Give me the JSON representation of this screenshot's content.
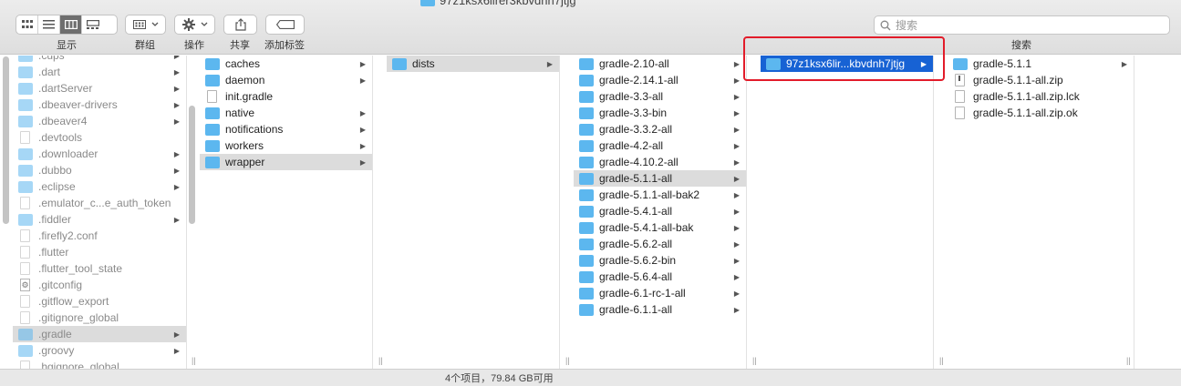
{
  "window": {
    "title": "97z1ksx6lirer3kbvdnh7jtjg"
  },
  "toolbar": {
    "view_label": "显示",
    "group_label": "群组",
    "action_label": "操作",
    "share_label": "共享",
    "tag_label": "添加标签",
    "search_label": "搜索",
    "search_placeholder": "搜索"
  },
  "columns": {
    "c1": [
      {
        "name": ".cups",
        "type": "folder",
        "arrow": true
      },
      {
        "name": ".dart",
        "type": "folder",
        "arrow": true
      },
      {
        "name": ".dartServer",
        "type": "folder",
        "arrow": true
      },
      {
        "name": ".dbeaver-drivers",
        "type": "folder",
        "arrow": true
      },
      {
        "name": ".dbeaver4",
        "type": "folder",
        "arrow": true
      },
      {
        "name": ".devtools",
        "type": "file",
        "arrow": false
      },
      {
        "name": ".downloader",
        "type": "folder",
        "arrow": true
      },
      {
        "name": ".dubbo",
        "type": "folder",
        "arrow": true
      },
      {
        "name": ".eclipse",
        "type": "folder",
        "arrow": true
      },
      {
        "name": ".emulator_c...e_auth_token",
        "type": "file",
        "arrow": false
      },
      {
        "name": ".fiddler",
        "type": "folder",
        "arrow": true
      },
      {
        "name": ".firefly2.conf",
        "type": "file",
        "arrow": false
      },
      {
        "name": ".flutter",
        "type": "file",
        "arrow": false
      },
      {
        "name": ".flutter_tool_state",
        "type": "file",
        "arrow": false
      },
      {
        "name": ".gitconfig",
        "type": "gear",
        "arrow": false
      },
      {
        "name": ".gitflow_export",
        "type": "file",
        "arrow": false
      },
      {
        "name": ".gitignore_global",
        "type": "file",
        "arrow": false
      },
      {
        "name": ".gradle",
        "type": "folder",
        "arrow": true,
        "state": "sel"
      },
      {
        "name": ".groovy",
        "type": "folder",
        "arrow": true
      },
      {
        "name": ".hgignore_global",
        "type": "file",
        "arrow": false
      }
    ],
    "c2": [
      {
        "name": "caches",
        "type": "folder",
        "arrow": true
      },
      {
        "name": "daemon",
        "type": "folder",
        "arrow": true
      },
      {
        "name": "init.gradle",
        "type": "file",
        "arrow": false
      },
      {
        "name": "native",
        "type": "folder",
        "arrow": true
      },
      {
        "name": "notifications",
        "type": "folder",
        "arrow": true
      },
      {
        "name": "workers",
        "type": "folder",
        "arrow": true
      },
      {
        "name": "wrapper",
        "type": "folder",
        "arrow": true,
        "state": "sel"
      }
    ],
    "c3": [
      {
        "name": "dists",
        "type": "folder",
        "arrow": true,
        "state": "sel"
      }
    ],
    "c4": [
      {
        "name": "gradle-2.10-all",
        "type": "folder",
        "arrow": true
      },
      {
        "name": "gradle-2.14.1-all",
        "type": "folder",
        "arrow": true
      },
      {
        "name": "gradle-3.3-all",
        "type": "folder",
        "arrow": true
      },
      {
        "name": "gradle-3.3-bin",
        "type": "folder",
        "arrow": true
      },
      {
        "name": "gradle-3.3.2-all",
        "type": "folder",
        "arrow": true
      },
      {
        "name": "gradle-4.2-all",
        "type": "folder",
        "arrow": true
      },
      {
        "name": "gradle-4.10.2-all",
        "type": "folder",
        "arrow": true
      },
      {
        "name": "gradle-5.1.1-all",
        "type": "folder",
        "arrow": true,
        "state": "sel"
      },
      {
        "name": "gradle-5.1.1-all-bak2",
        "type": "folder",
        "arrow": true
      },
      {
        "name": "gradle-5.4.1-all",
        "type": "folder",
        "arrow": true
      },
      {
        "name": "gradle-5.4.1-all-bak",
        "type": "folder",
        "arrow": true
      },
      {
        "name": "gradle-5.6.2-all",
        "type": "folder",
        "arrow": true
      },
      {
        "name": "gradle-5.6.2-bin",
        "type": "folder",
        "arrow": true
      },
      {
        "name": "gradle-5.6.4-all",
        "type": "folder",
        "arrow": true
      },
      {
        "name": "gradle-6.1-rc-1-all",
        "type": "folder",
        "arrow": true
      },
      {
        "name": "gradle-6.1.1-all",
        "type": "folder",
        "arrow": true
      }
    ],
    "c5": [
      {
        "name": "97z1ksx6lir...kbvdnh7jtjg",
        "type": "folder",
        "arrow": true,
        "state": "act"
      }
    ],
    "c6": [
      {
        "name": "gradle-5.1.1",
        "type": "folder",
        "arrow": true
      },
      {
        "name": "gradle-5.1.1-all.zip",
        "type": "zip",
        "arrow": false
      },
      {
        "name": "gradle-5.1.1-all.zip.lck",
        "type": "file",
        "arrow": false
      },
      {
        "name": "gradle-5.1.1-all.zip.ok",
        "type": "file",
        "arrow": false
      }
    ]
  },
  "status": {
    "text": "4个项目，79.84 GB可用"
  },
  "colors": {
    "selection": "#1762d4",
    "folder": "#5cb7ef",
    "highlight_box": "#e21c2a"
  }
}
